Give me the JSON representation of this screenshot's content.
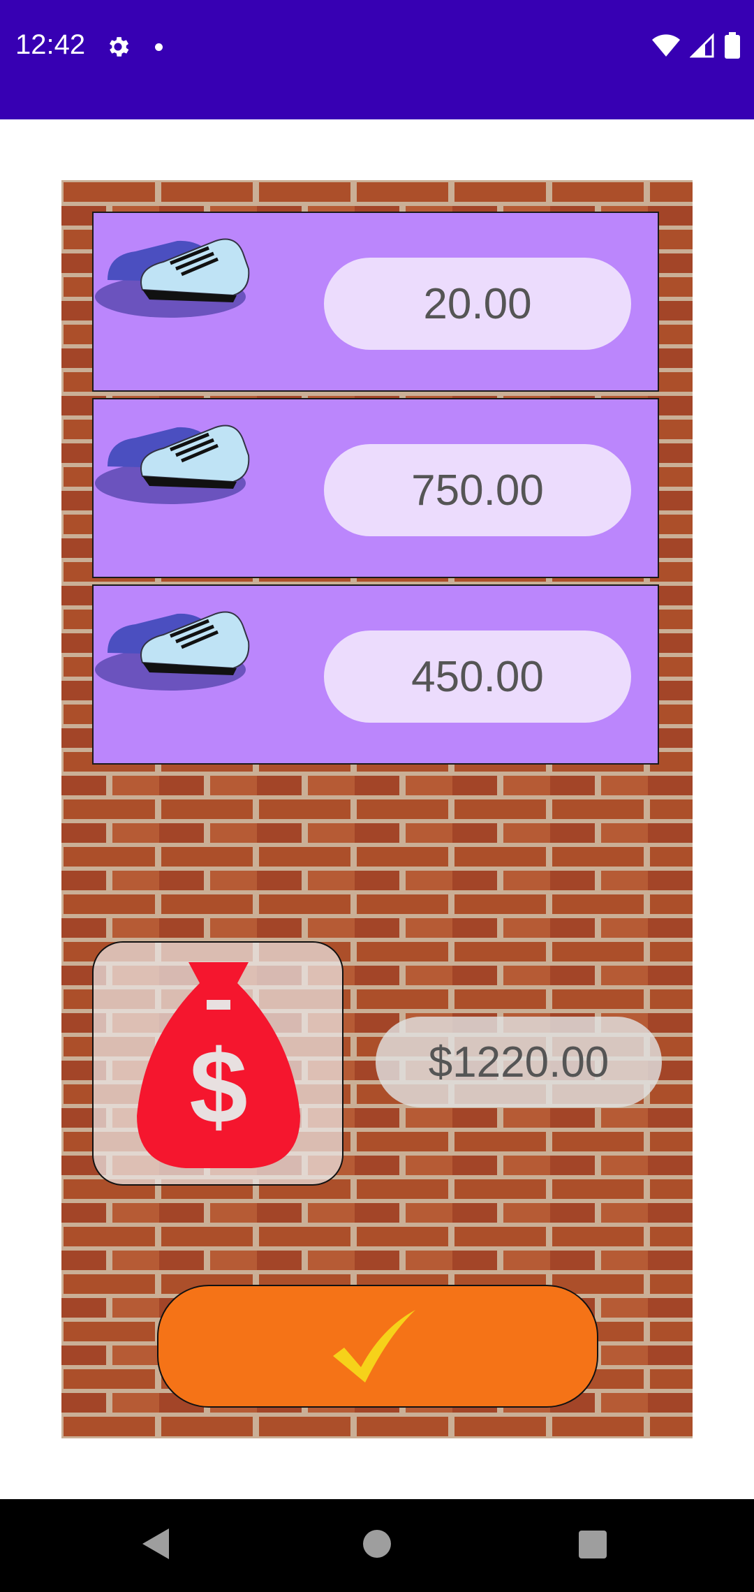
{
  "status_bar": {
    "time": "12:42"
  },
  "items": [
    {
      "price": "20.00",
      "icon": "sneakers-icon"
    },
    {
      "price": "750.00",
      "icon": "sneakers-icon"
    },
    {
      "price": "450.00",
      "icon": "sneakers-icon"
    }
  ],
  "total": {
    "amount": "$1220.00",
    "icon": "money-bag-icon"
  },
  "confirm": {
    "icon": "checkmark-icon"
  },
  "colors": {
    "status_bar": "#3700b3",
    "card": "#bb86fc",
    "price_pill": "#ecdcfd",
    "confirm_button": "#f57317",
    "money_bag": "#f5162e",
    "check": "#f6d21a"
  }
}
